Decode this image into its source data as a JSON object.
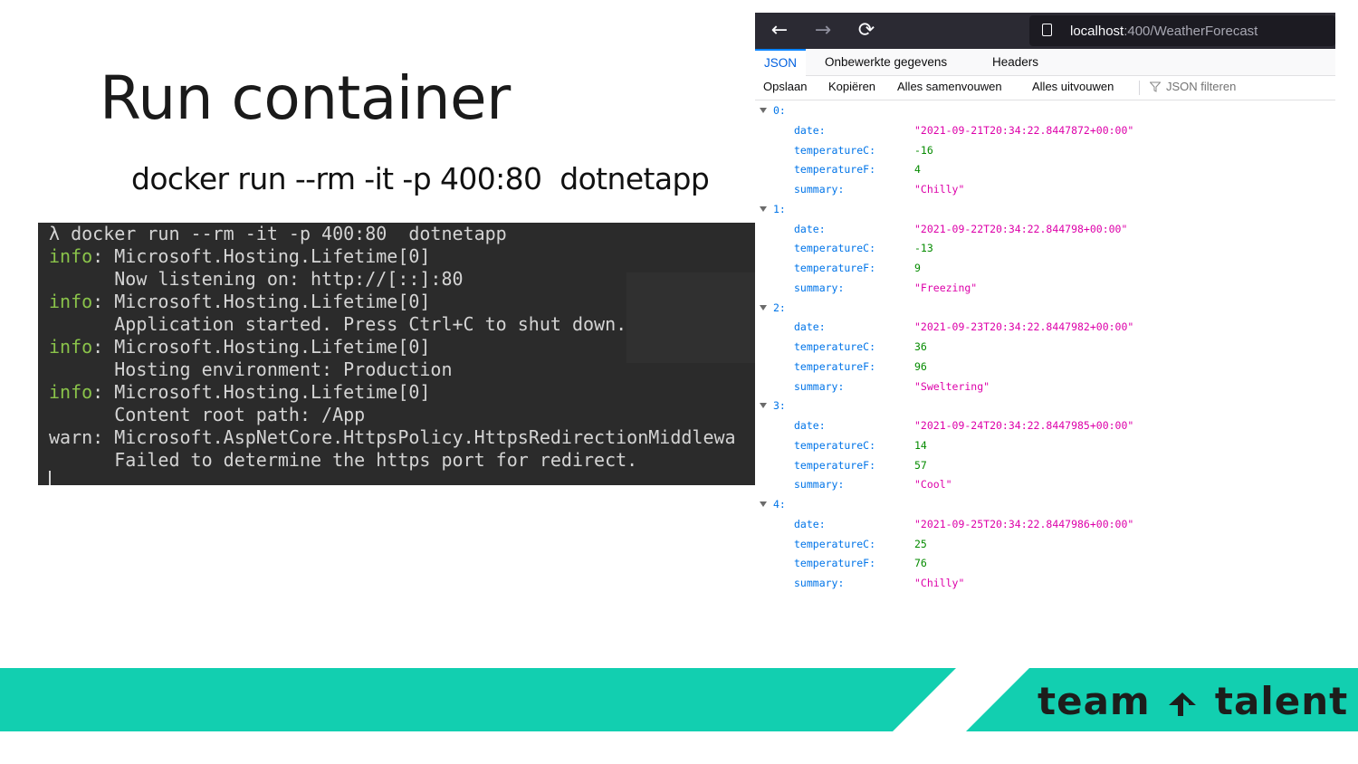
{
  "slide": {
    "title": "Run container",
    "command": "docker run --rm -it -p 400:80  dotnetapp"
  },
  "terminal": {
    "lines": [
      {
        "prefix": "",
        "text": "λ docker run --rm -it -p 400:80  dotnetapp"
      },
      {
        "prefix": "info",
        "text": ": Microsoft.Hosting.Lifetime[0]"
      },
      {
        "prefix": "",
        "text": "      Now listening on: http://[::]:80"
      },
      {
        "prefix": "info",
        "text": ": Microsoft.Hosting.Lifetime[0]"
      },
      {
        "prefix": "",
        "text": "      Application started. Press Ctrl+C to shut down."
      },
      {
        "prefix": "info",
        "text": ": Microsoft.Hosting.Lifetime[0]"
      },
      {
        "prefix": "",
        "text": "      Hosting environment: Production"
      },
      {
        "prefix": "info",
        "text": ": Microsoft.Hosting.Lifetime[0]"
      },
      {
        "prefix": "",
        "text": "      Content root path: /App"
      },
      {
        "prefix": "warn",
        "text": ": Microsoft.AspNetCore.HttpsPolicy.HttpsRedirectionMiddlewa"
      },
      {
        "prefix": "",
        "text": "      Failed to determine the https port for redirect."
      }
    ]
  },
  "browser": {
    "back_icon": "←",
    "forward_icon": "→",
    "reload_icon": "⟳",
    "url_host": "localhost",
    "url_path": ":400/WeatherForecast",
    "tabs": [
      {
        "label": "JSON",
        "active": true
      },
      {
        "label": "Onbewerkte gegevens",
        "active": false
      },
      {
        "label": "Headers",
        "active": false
      }
    ],
    "toolbar": {
      "save": "Opslaan",
      "copy": "Kopiëren",
      "collapse_all": "Alles samenvouwen",
      "expand_all": "Alles uitvouwen",
      "filter_placeholder": "JSON filteren"
    },
    "json_items": [
      {
        "index": "0:",
        "date": "\"2021-09-21T20:34:22.8447872+00:00\"",
        "temperatureC": "-16",
        "temperatureF": "4",
        "summary": "\"Chilly\""
      },
      {
        "index": "1:",
        "date": "\"2021-09-22T20:34:22.844798+00:00\"",
        "temperatureC": "-13",
        "temperatureF": "9",
        "summary": "\"Freezing\""
      },
      {
        "index": "2:",
        "date": "\"2021-09-23T20:34:22.8447982+00:00\"",
        "temperatureC": "36",
        "temperatureF": "96",
        "summary": "\"Sweltering\""
      },
      {
        "index": "3:",
        "date": "\"2021-09-24T20:34:22.8447985+00:00\"",
        "temperatureC": "14",
        "temperatureF": "57",
        "summary": "\"Cool\""
      },
      {
        "index": "4:",
        "date": "\"2021-09-25T20:34:22.8447986+00:00\"",
        "temperatureC": "25",
        "temperatureF": "76",
        "summary": "\"Chilly\""
      }
    ],
    "keys": {
      "date": "date:",
      "temperatureC": "temperatureC:",
      "temperatureF": "temperatureF:",
      "summary": "summary:"
    }
  },
  "footer": {
    "band_color": "#12cfb0",
    "logo_left": "team",
    "logo_right": "talent"
  }
}
